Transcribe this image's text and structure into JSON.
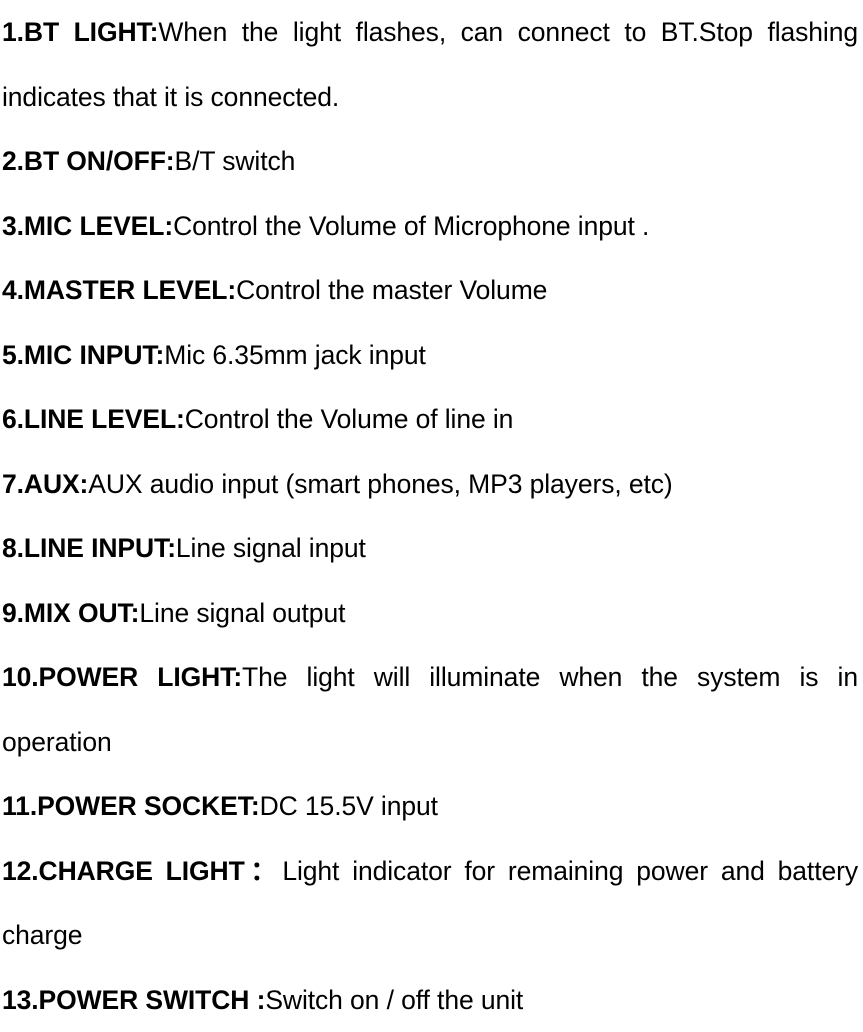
{
  "document": {
    "type": "product-feature-list",
    "items": [
      {
        "index": "1",
        "label": "1.BT  LIGHT:",
        "description": "When  the  light  flashes,  can  connect  to  BT.Stop  flashing indicates that it is connected.",
        "wraps": true
      },
      {
        "index": "2",
        "label": "2.BT ON/OFF:",
        "description": "B/T switch",
        "wraps": false
      },
      {
        "index": "3",
        "label": "3.MIC LEVEL:",
        "description": "Control the Volume of Microphone input .",
        "wraps": false
      },
      {
        "index": "4",
        "label": "4.MASTER LEVEL:",
        "description": "Control the master Volume",
        "wraps": false
      },
      {
        "index": "5",
        "label": "5.MIC INPUT:",
        "description": "Mic 6.35mm jack input",
        "wraps": false
      },
      {
        "index": "6",
        "label": "6.LINE LEVEL:",
        "description": "Control the Volume of line in",
        "wraps": false
      },
      {
        "index": "7",
        "label": "7.AUX:",
        "description": "AUX audio input (smart phones, MP3 players, etc)",
        "wraps": false
      },
      {
        "index": "8",
        "label": "8.LINE INPUT:",
        "description": "Line signal input",
        "wraps": false
      },
      {
        "index": "9",
        "label": "9.MIX OUT:",
        "description": "Line signal output",
        "wraps": false
      },
      {
        "index": "10",
        "label": "10.POWER  LIGHT:",
        "description": "The  light  will  illuminate  when  the  system  is  in operation",
        "wraps": true
      },
      {
        "index": "11",
        "label": "11.POWER SOCKET:",
        "description": "DC 15.5V input",
        "wraps": false
      },
      {
        "index": "12",
        "label": "12.CHARGE  LIGHT：",
        "description": "Light  indicator  for  remaining  power  and  battery charge",
        "wraps": true
      },
      {
        "index": "13",
        "label": "13.POWER SWITCH :",
        "description": "Switch on / off the unit",
        "wraps": false
      }
    ]
  }
}
